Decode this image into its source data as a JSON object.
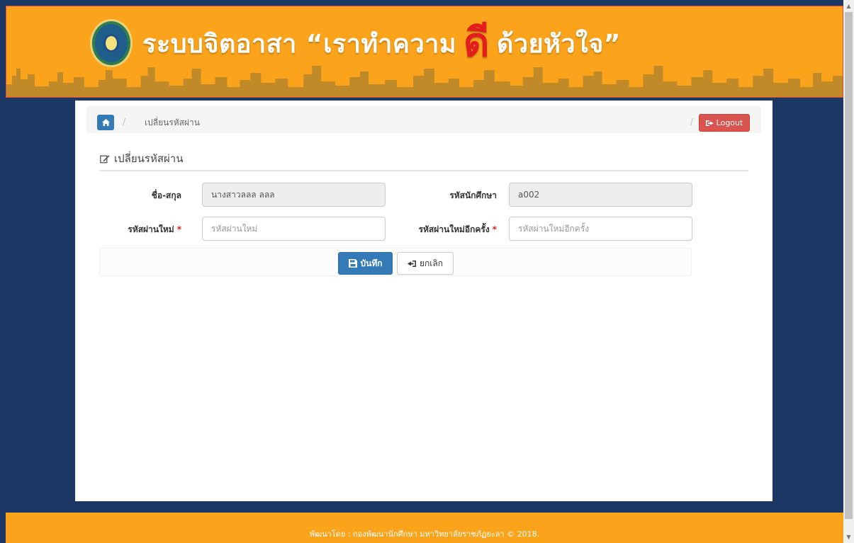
{
  "banner": {
    "title_part1": "ระบบจิตอาสา “เราทำความ",
    "title_accent": "ดี",
    "title_part2": "ด้วยหัวใจ”"
  },
  "breadcrumb": {
    "current": "เปลี่ยนรหัสผ่าน",
    "logout_label": "Logout"
  },
  "form": {
    "section_title": "เปลี่ยนรหัสผ่าน",
    "name_label": "ชื่อ-สกุล",
    "name_value": "นางสาวลลล ลลล",
    "student_id_label": "รหัสนักศึกษา",
    "student_id_value": "a002",
    "new_password_label": "รหัสผ่านใหม่",
    "new_password_placeholder": "รหัสผ่านใหม่",
    "confirm_password_label": "รหัสผ่านใหม่อีกครั้ง",
    "confirm_password_placeholder": "รหัสผ่านใหม่อีกครั้ง",
    "required_mark": "*",
    "save_label": "บันทึก",
    "cancel_label": "ยกเลิก"
  },
  "footer": {
    "text": "พัฒนาโดย : กองพัฒนานักศึกษา มหาวิทยาลัยราชภัฏยะลา © 2018."
  },
  "colors": {
    "header_orange": "#fba41b",
    "navy_background": "#1c3764",
    "primary_blue": "#337ab7",
    "logout_red": "#d9534f",
    "accent_red": "#e31d1d"
  },
  "icons": {
    "home": "home-icon",
    "logout": "sign-out-icon",
    "edit": "edit-icon",
    "save": "floppy-disk-icon",
    "cancel": "sign-in-icon"
  }
}
